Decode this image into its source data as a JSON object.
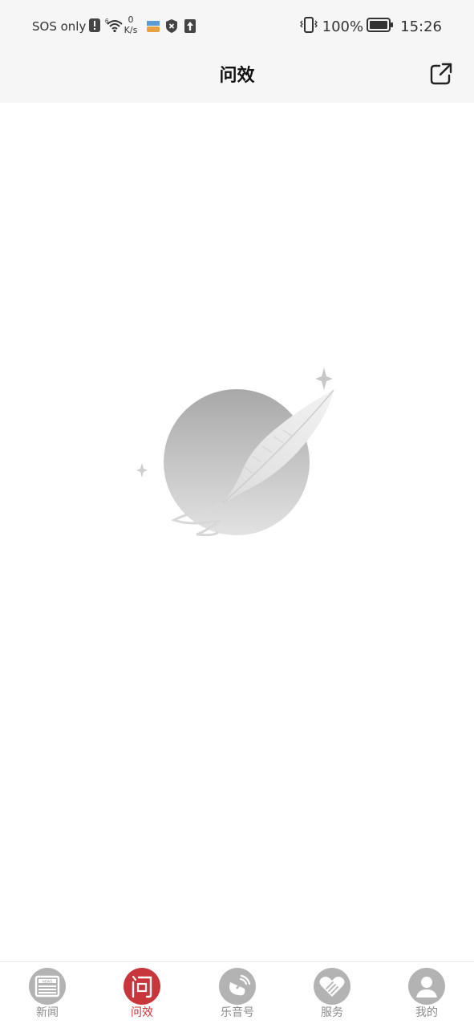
{
  "status_bar": {
    "carrier": "SOS only",
    "net_speed_value": "0",
    "net_speed_unit": "K/s",
    "battery_percent": "100%",
    "time": "15:26"
  },
  "header": {
    "title": "问效",
    "share_icon": "open-external-icon"
  },
  "content": {
    "illustration": "empty-state-feather-icon"
  },
  "bottom_nav": {
    "active_index": 1,
    "accent_color": "#c8353b",
    "inactive_color": "#8c8c8c",
    "items": [
      {
        "label": "新闻",
        "icon": "news-icon"
      },
      {
        "label": "问效",
        "icon": "question-icon"
      },
      {
        "label": "乐音号",
        "icon": "satellite-dish-icon"
      },
      {
        "label": "服务",
        "icon": "heart-handshake-icon"
      },
      {
        "label": "我的",
        "icon": "user-icon"
      }
    ]
  }
}
